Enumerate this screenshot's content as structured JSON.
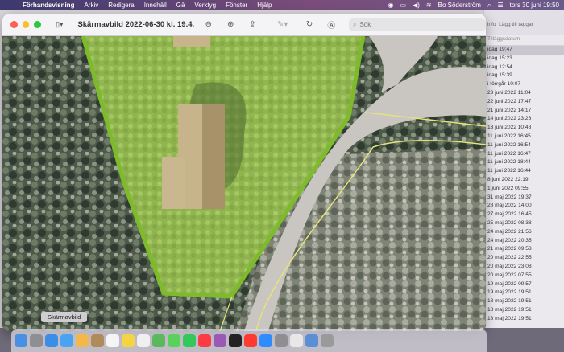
{
  "menubar": {
    "app": "Förhandsvisning",
    "menus": [
      "Arkiv",
      "Redigera",
      "Innehåll",
      "Gå",
      "Verktyg",
      "Fönster",
      "Hjälp"
    ],
    "user": "Bo Söderström",
    "datetime": "tors 30 juni  19:50"
  },
  "window": {
    "title": "Skärmavbild 2022-06-30 kl. 19.4...",
    "search_placeholder": "Sök"
  },
  "tooltip": "Skärmavbild",
  "finder": {
    "toolbar_labels": [
      "info",
      "Lägg till taggar"
    ],
    "column_header": "Tilläggsdatum",
    "items": [
      "idag 19:47",
      "idag 15:23",
      "idag 12:54",
      "idag 15:39",
      "i förrgår 10:07",
      "23 juni 2022 11:04",
      "22 juni 2022 17:47",
      "21 juni 2022 14:17",
      "14 juni 2022 23:26",
      "13 juni 2022 10:48",
      "11 juni 2022 16:45",
      "11 juni 2022 16:54",
      "11 juni 2022 16:47",
      "11 juni 2022 18:44",
      "11 juni 2022 16:44",
      "8 juni 2022 22:19",
      "1 juni 2022 09:55",
      "31 maj 2022 19:37",
      "28 maj 2022 14:00",
      "27 maj 2022 16:45",
      "25 maj 2022 08:38",
      "24 maj 2022 21:56",
      "24 maj 2022 20:35",
      "21 maj 2022 09:53",
      "20 maj 2022 22:55",
      "20 maj 2022 23:08",
      "20 maj 2022 07:55",
      "19 maj 2022 09:57",
      "19 maj 2022 19:51",
      "18 maj 2022 19:51",
      "18 maj 2022 19:51",
      "18 maj 2022 19:51"
    ]
  },
  "colors": {
    "plot_outline": "#7dbb2a",
    "plot_fill": "#a9d35a",
    "boundary_line": "#e5e37a",
    "road": "#c9c6c2"
  },
  "dock_icons": [
    "finder-icon",
    "launchpad-icon",
    "safari-icon",
    "mail-icon",
    "photos-icon",
    "contacts-icon",
    "calendar-icon",
    "notes-icon",
    "reminders-icon",
    "maps-icon",
    "messages-icon",
    "facetime-icon",
    "music-icon",
    "podcasts-icon",
    "tv-icon",
    "news-icon",
    "app-store-icon",
    "system-preferences-icon",
    "chrome-icon",
    "preview-icon",
    "trash-icon"
  ]
}
